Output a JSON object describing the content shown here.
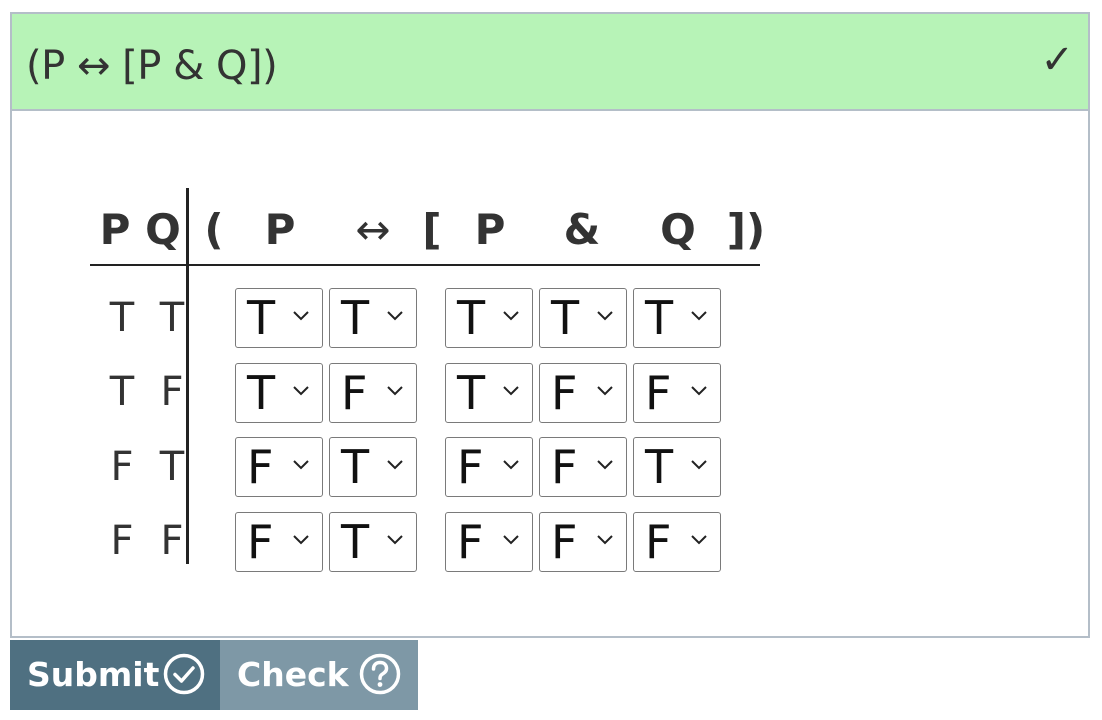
{
  "problem": {
    "formula": "(P ↔ [P & Q])",
    "status_mark": "✓",
    "status_color": "#b7f3b7"
  },
  "table": {
    "var_headers": [
      "P",
      "Q"
    ],
    "formula_headers": [
      "(",
      "P",
      "↔",
      "[",
      "P",
      "&",
      "Q",
      "])"
    ],
    "rows": [
      {
        "vars": [
          "T",
          "T"
        ],
        "answers": [
          "T",
          "T",
          "T",
          "T",
          "T"
        ]
      },
      {
        "vars": [
          "T",
          "F"
        ],
        "answers": [
          "T",
          "F",
          "T",
          "F",
          "F"
        ]
      },
      {
        "vars": [
          "F",
          "T"
        ],
        "answers": [
          "F",
          "T",
          "F",
          "F",
          "T"
        ]
      },
      {
        "vars": [
          "F",
          "F"
        ],
        "answers": [
          "F",
          "T",
          "F",
          "F",
          "F"
        ]
      }
    ]
  },
  "actions": {
    "submit_label": "Submit",
    "check_label": "Check",
    "submit_icon": "check-circle-icon",
    "check_icon": "question-circle-icon",
    "submit_color": "#4f7081",
    "check_color": "#7e98a6"
  }
}
